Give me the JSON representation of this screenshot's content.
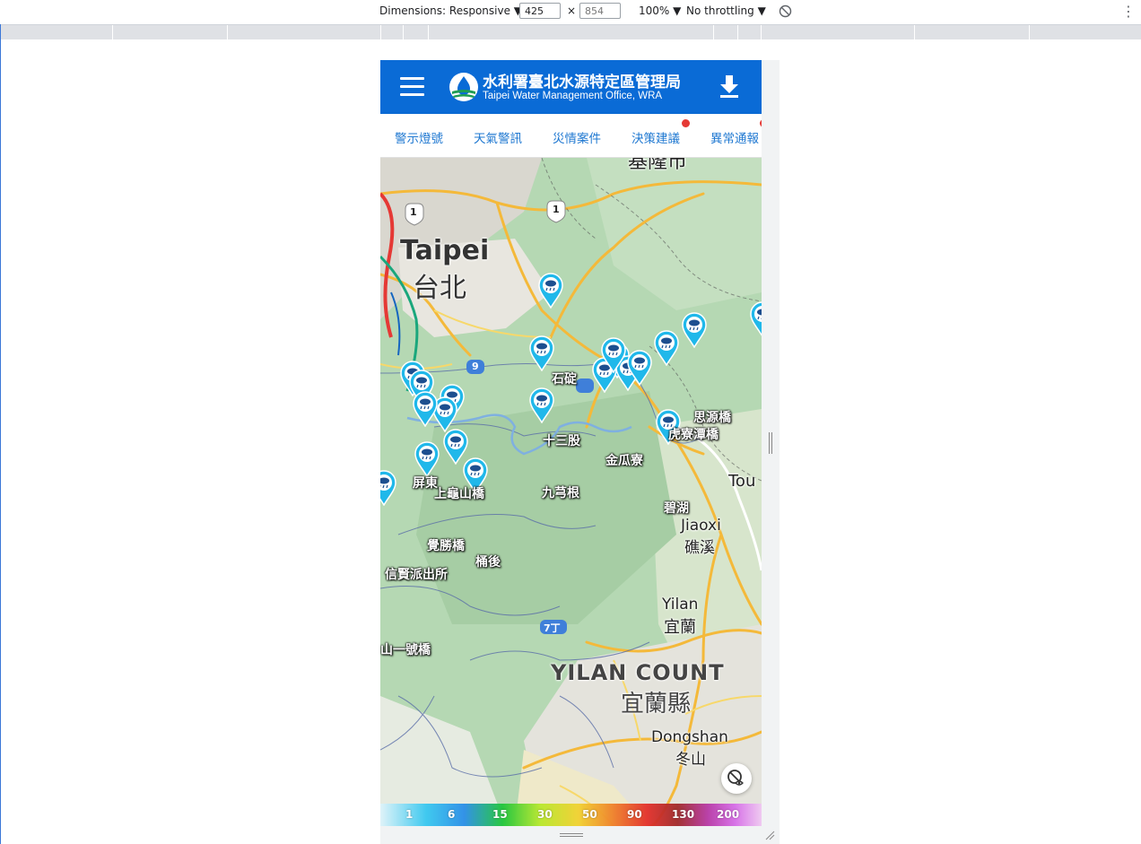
{
  "devtools": {
    "dimensions_label": "Dimensions: Responsive",
    "width": "425",
    "times": "×",
    "height": "854",
    "zoom": "100%",
    "throttling": "No throttling"
  },
  "header": {
    "title_zh": "水利署臺北水源特定區管理局",
    "title_en": "Taipei Water Management Office, WRA"
  },
  "tabs": [
    "警示燈號",
    "天氣警訊",
    "災情案件",
    "決策建議",
    "異常通報"
  ],
  "colors": {
    "header_bg": "#0a6bd6",
    "tab_text": "#1f78d1",
    "notify_dot": "#e53935",
    "pin": "#20b8ea"
  },
  "map": {
    "place_labels": {
      "keelung": "基隆市",
      "taipei_en": "Taipei",
      "taipei_zh": "台北",
      "jiaoxi_en": "Jiaoxi",
      "jiaoxi_zh": "礁溪",
      "yilan_en": "Yilan",
      "yilan_zh": "宜蘭",
      "yilan_county_en": "YILAN COUNT",
      "yilan_county_zh": "宜蘭縣",
      "dongshan_en": "Dongshan",
      "dongshan_zh": "冬山",
      "tou": "Tou",
      "route_1a": "1",
      "route_1b": "1",
      "route_9": "9",
      "route_7": "7丁"
    },
    "stations": {
      "shiding": "石碇",
      "sihyuan": "思源橋",
      "hulioutan": "虎寮潭橋",
      "shisangu": "十三股",
      "jinguanliao": "金瓜寮",
      "jiuqionggen": "九芎根",
      "bisheng": "碧湖",
      "qiaoqiao": "覺勝橋",
      "tonghou": "桶後",
      "xinxian": "信賢派出所",
      "shanyihao": "山一號橋",
      "pingguang": "屏東",
      "beishi": "上龜山橋"
    },
    "legend_values": [
      "1",
      "6",
      "15",
      "30",
      "50",
      "90",
      "130",
      "200"
    ]
  }
}
